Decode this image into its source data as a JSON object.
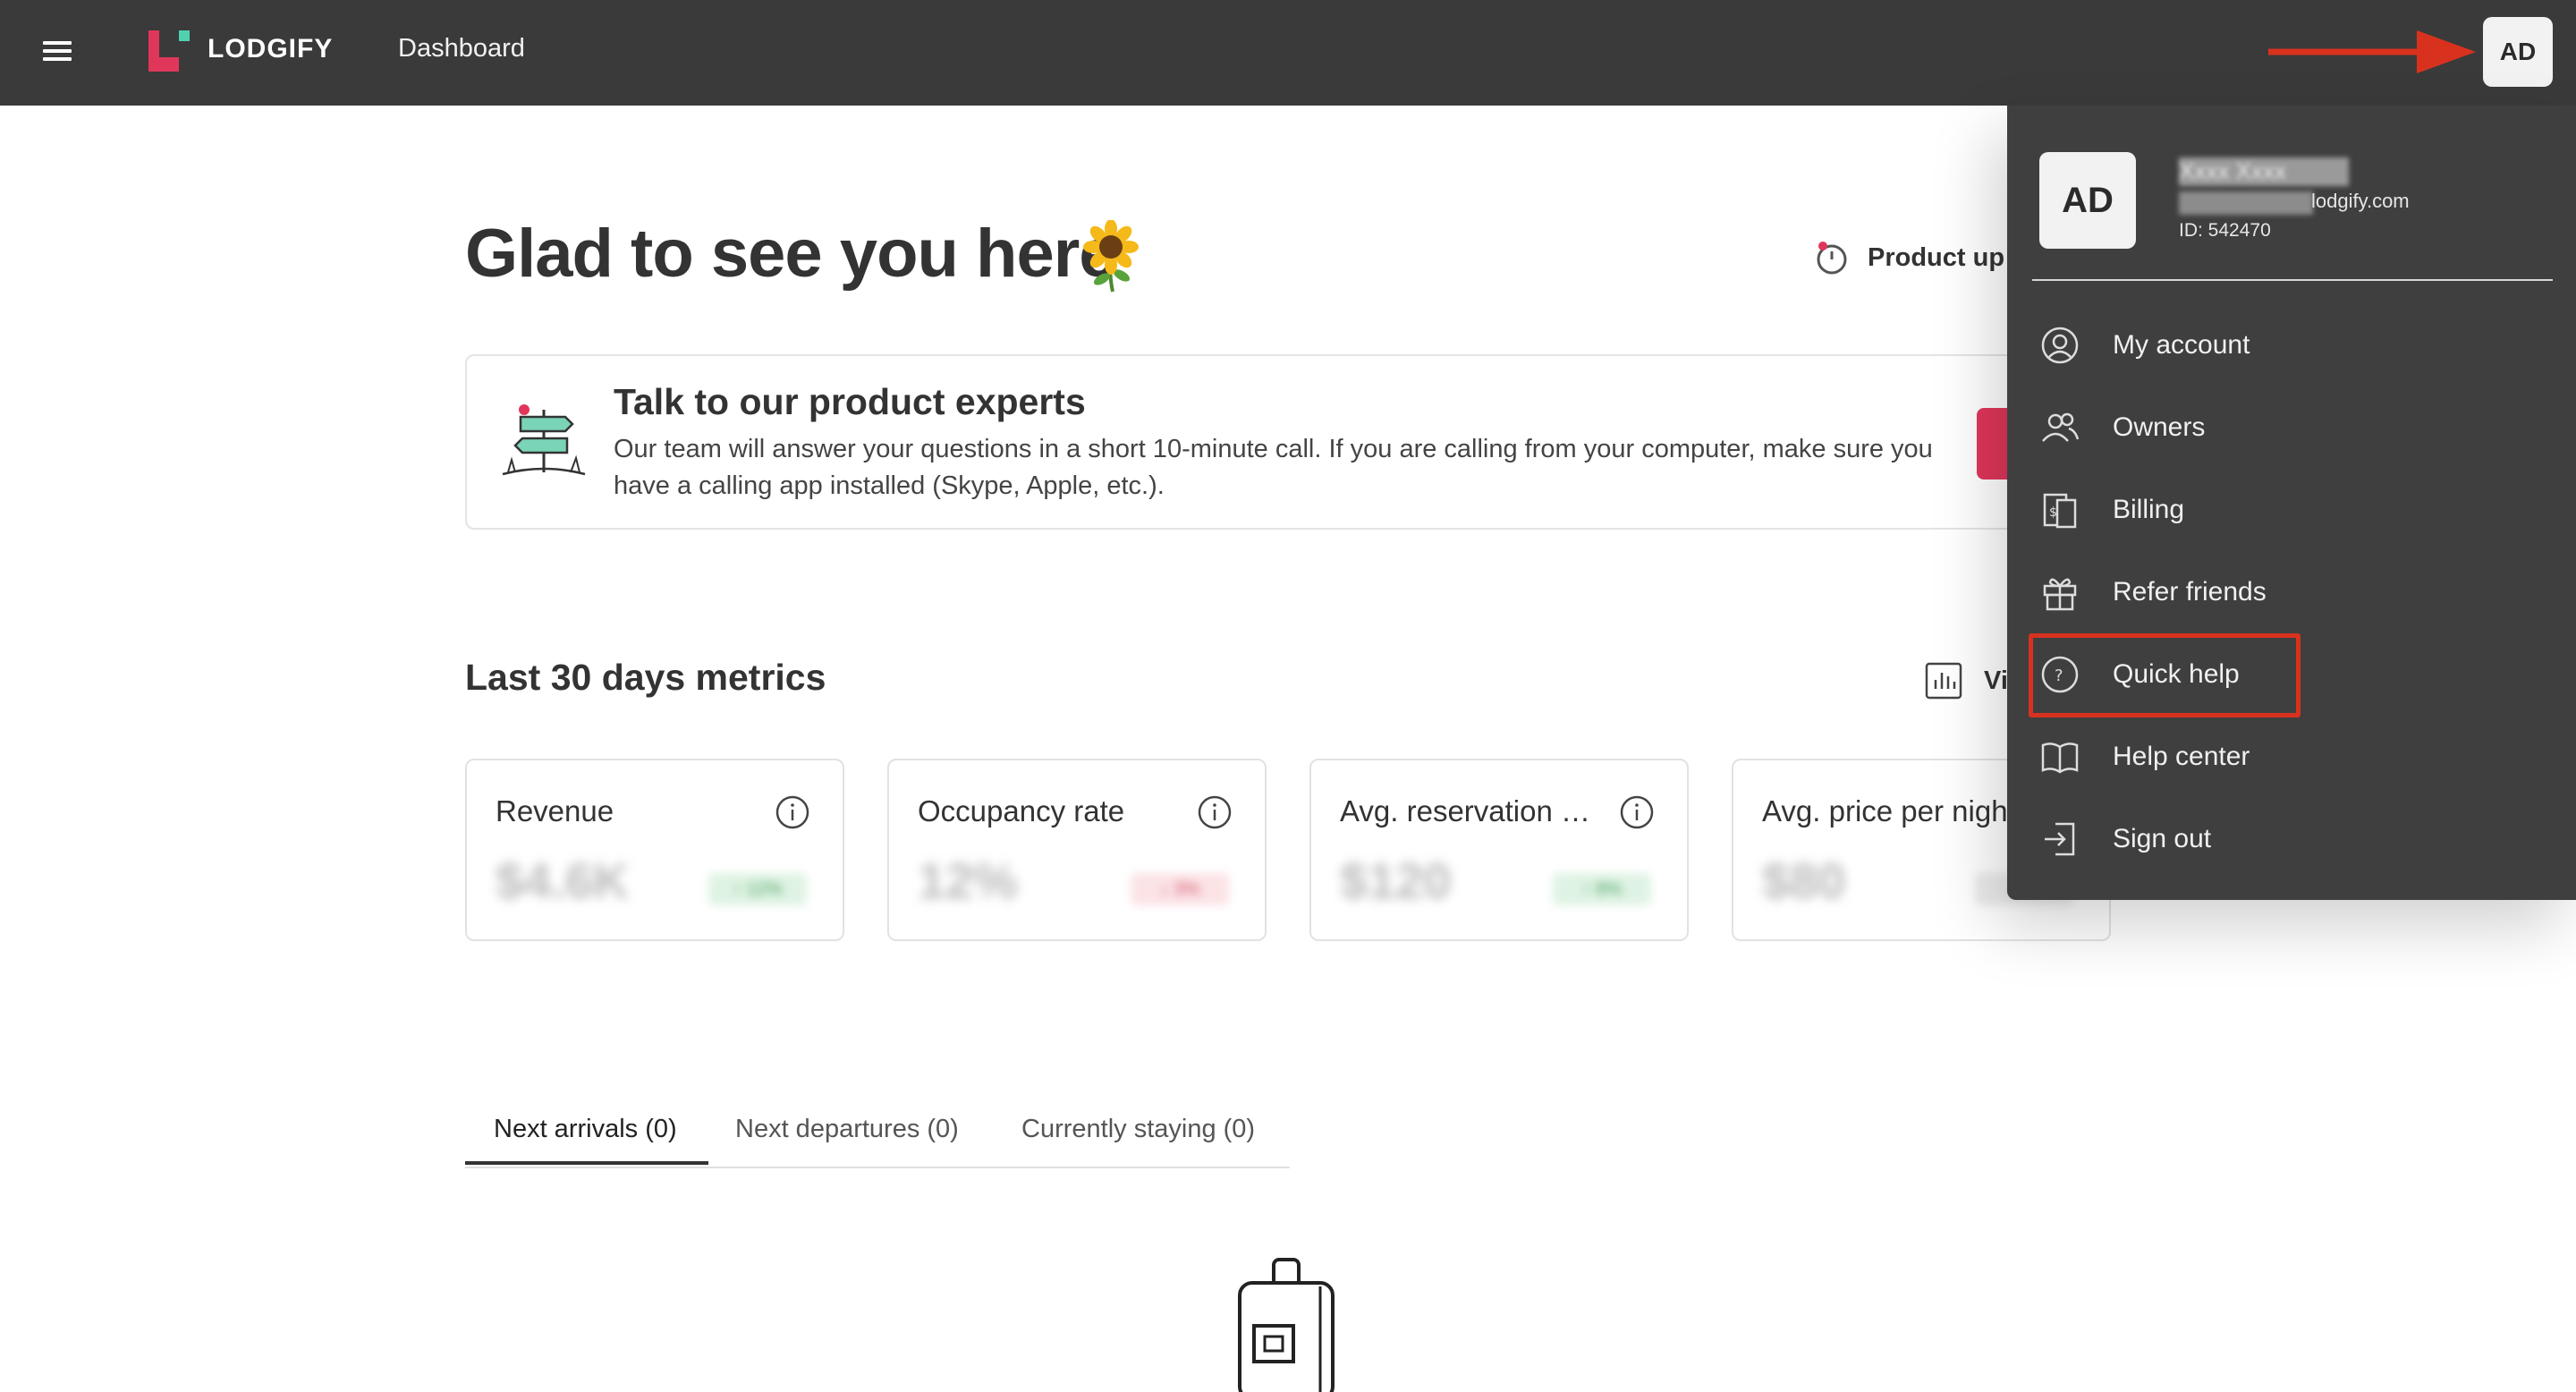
{
  "topbar": {
    "brand": "LODGIFY",
    "nav_title": "Dashboard",
    "avatar_initials": "AD",
    "bar_color": "#3a3a3a",
    "brand_color": "#e0365a"
  },
  "main": {
    "greeting": "Glad to see you here",
    "greeting_emoji": "sunflower-icon",
    "product_updates": "Product up",
    "expert_card": {
      "title": "Talk to our product experts",
      "body": "Our team will answer your questions in a short 10-minute call. If you are calling from your computer, make sure you have a calling app installed (Skype, Apple, etc.)."
    },
    "metrics_title": "Last 30 days metrics",
    "view_report": "Vi",
    "metrics": [
      {
        "label": "Revenue",
        "value": "$4.6K",
        "delta": "↑ 12%",
        "trend": "up"
      },
      {
        "label": "Occupancy rate",
        "value": "12%",
        "delta": "↓ 3%",
        "trend": "down"
      },
      {
        "label": "Avg. reservation …",
        "value": "$120",
        "delta": "↑ 8%",
        "trend": "up"
      },
      {
        "label": "Avg. price per nigh",
        "value": "$80",
        "delta": "0%",
        "trend": "neutral"
      }
    ],
    "tabs": [
      {
        "label": "Next arrivals (0)"
      },
      {
        "label": "Next departures (0)"
      },
      {
        "label": "Currently staying (0)"
      }
    ]
  },
  "dropdown": {
    "avatar_initials": "AD",
    "user_name": "Xxxx Xxxx",
    "email": "lodgify.com",
    "id": "ID: 542470",
    "items": [
      {
        "label": "My account",
        "icon": "user-circle-icon"
      },
      {
        "label": "Owners",
        "icon": "users-icon"
      },
      {
        "label": "Billing",
        "icon": "billing-icon"
      },
      {
        "label": "Refer friends",
        "icon": "gift-icon"
      },
      {
        "label": "Quick help",
        "icon": "question-circle-icon"
      },
      {
        "label": "Help center",
        "icon": "book-icon"
      },
      {
        "label": "Sign out",
        "icon": "sign-out-icon"
      }
    ],
    "highlight_color": "#d8321e"
  }
}
